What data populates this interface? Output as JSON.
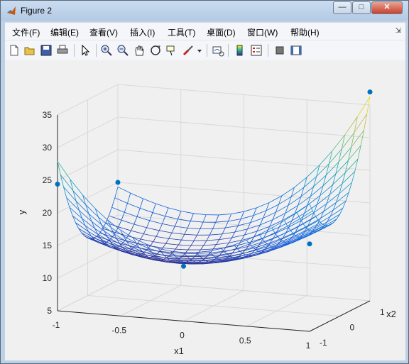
{
  "window": {
    "title": "Figure 2",
    "minimize_glyph": "—",
    "maximize_glyph": "□",
    "close_glyph": "✕"
  },
  "menu": {
    "items": [
      "文件(F)",
      "编辑(E)",
      "查看(V)",
      "插入(I)",
      "工具(T)",
      "桌面(D)",
      "窗口(W)",
      "帮助(H)"
    ],
    "expand_glyph": "⇲"
  },
  "toolbar": {
    "icons": [
      "new-figure-icon",
      "open-file-icon",
      "save-icon",
      "print-icon",
      "pointer-icon",
      "zoom-in-icon",
      "zoom-out-icon",
      "pan-icon",
      "rotate-3d-icon",
      "data-cursor-icon",
      "brush-icon",
      "brush-dropdown-icon",
      "link-plot-icon",
      "colorbar-icon",
      "legend-icon",
      "hide-plot-tools-icon",
      "show-plot-tools-icon"
    ]
  },
  "chart_data": {
    "type": "surface",
    "function": "y = (1+x1)^2 + (1+x2)^2 ... (quadratic bowl shown as mesh)",
    "xlabel": "x1",
    "ylabel": "y",
    "zlabel": "x2",
    "x1_range": [
      -1,
      1
    ],
    "x2_range": [
      -1,
      1
    ],
    "y_range": [
      5,
      35
    ],
    "x1_ticks": [
      "-1",
      "-0.5",
      "0",
      "0.5",
      "1"
    ],
    "x2_ticks": [
      "-1",
      "0",
      "1"
    ],
    "y_ticks": [
      "5",
      "10",
      "15",
      "20",
      "25",
      "30",
      "35"
    ],
    "grid": true,
    "colormap": "parula",
    "points": [
      {
        "x1": -1,
        "x2": -1,
        "y": 24.4
      },
      {
        "x1": -1,
        "x2": 1,
        "y": 20.0
      },
      {
        "x1": 0,
        "x2": -1,
        "y": 13.4
      },
      {
        "x1": 1,
        "x2": -1,
        "y": 18.4
      },
      {
        "x1": 1,
        "x2": 1,
        "y": 37.0
      }
    ],
    "point_color": "#0072bd"
  }
}
